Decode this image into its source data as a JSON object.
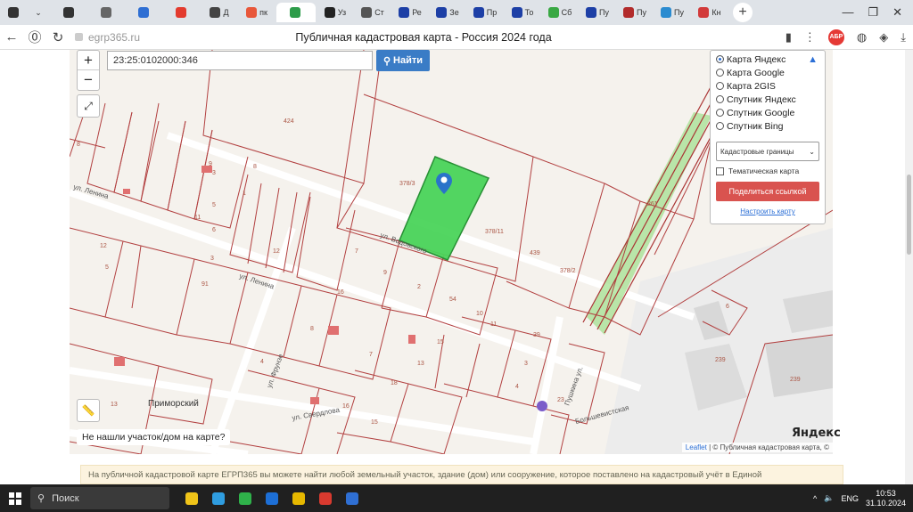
{
  "browser": {
    "tabs": [
      {
        "label": "",
        "color": "#333333"
      },
      {
        "label": "",
        "color": "#666666"
      },
      {
        "label": "",
        "color": "#2f6fd3"
      },
      {
        "label": "",
        "color": "#e33b2e"
      },
      {
        "label": "Д",
        "color": "#444444"
      },
      {
        "label": "пк",
        "color": "#e8573a"
      },
      {
        "label": "",
        "color": "#2d9c4a"
      },
      {
        "label": "Уз",
        "color": "#222222"
      },
      {
        "label": "Ст",
        "color": "#555555"
      },
      {
        "label": "Ре",
        "color": "#1d3fa6"
      },
      {
        "label": "Зе",
        "color": "#1d3fa6"
      },
      {
        "label": "Пр",
        "color": "#1d3fa6"
      },
      {
        "label": "То",
        "color": "#1d3fa6"
      },
      {
        "label": "Сб",
        "color": "#39a843"
      },
      {
        "label": "Пу",
        "color": "#1d3fa6"
      },
      {
        "label": "Пу",
        "color": "#b22b2b"
      },
      {
        "label": "Пу",
        "color": "#2a8bd0"
      },
      {
        "label": "Кн",
        "color": "#d23a3a"
      }
    ],
    "url": "egrp365.ru",
    "page_title": "Публичная кадастровая карта - Россия 2024 года",
    "badge": "АБР"
  },
  "map": {
    "search_value": "23:25:0102000:346",
    "find_label": "Найти",
    "layers": [
      {
        "label": "Карта Яндекс",
        "selected": true
      },
      {
        "label": "Карта Google",
        "selected": false
      },
      {
        "label": "Карта 2GIS",
        "selected": false
      },
      {
        "label": "Спутник Яндекс",
        "selected": false
      },
      {
        "label": "Спутник Google",
        "selected": false
      },
      {
        "label": "Спутник Bing",
        "selected": false
      }
    ],
    "boundaries_select": "Кадастровые границы",
    "thematic_label": "Тематическая карта",
    "share_label": "Поделиться ссылкой",
    "setup_label": "Настроить карту",
    "not_found": "Не нашли участок/дом на карте?",
    "attribution_leaflet": "Leaflet",
    "attribution_rest": "| © Публичная кадастровая карта, ©",
    "brand": "Яндекс",
    "place": "Приморский",
    "streets": [
      "ул. Ленина",
      "ул. Водовского",
      "ул. Ленина",
      "ул. Фрунзе",
      "ул. Свердлова",
      "Пушкина ул.",
      "Большевистская"
    ],
    "parcels": [
      "424",
      "378/3",
      "378/11",
      "439",
      "378/2",
      "261",
      "8",
      "3",
      "9",
      "5",
      "11",
      "12",
      "5",
      "6",
      "3",
      "12",
      "7",
      "9",
      "2",
      "54",
      "10",
      "11",
      "39",
      "8",
      "91",
      "16",
      "15",
      "7",
      "4",
      "18",
      "13",
      "16",
      "15",
      "4",
      "3",
      "23",
      "6",
      "239",
      "239",
      "1",
      "13",
      "8"
    ]
  },
  "notice": "На публичной кадастровой карте ЕГРП365 вы можете найти любой земельный участок, здание (дом) или сооружение, которое поставлено на кадастровый учёт в Единой",
  "taskbar": {
    "search": "Поиск",
    "lang": "ENG",
    "time": "10:53",
    "date": "31.10.2024",
    "apps": [
      "#f0c419",
      "#2f9de0",
      "#2fb24a",
      "#1d6fd6",
      "#e6b800",
      "#d93a2f",
      "#2f6fd3"
    ]
  }
}
